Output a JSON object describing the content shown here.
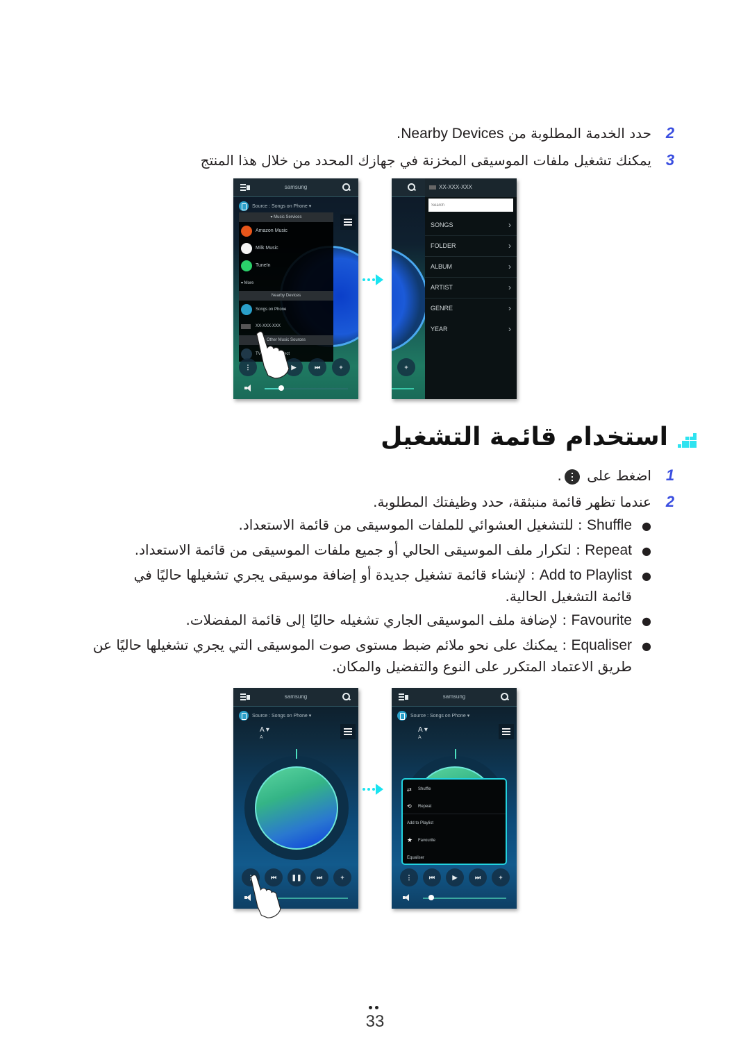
{
  "top_steps": [
    {
      "num": "2",
      "text_ar": "حدد الخدمة المطلوبة من",
      "text_latin": "Nearby Devices",
      "suffix": "."
    },
    {
      "num": "3",
      "text_ar": "يمكنك تشغيل ملفات الموسيقى المخزنة في جهازك المحدد من خلال هذا المنتج",
      "text_latin": "",
      "suffix": ""
    }
  ],
  "screen1": {
    "app_title": "samsung",
    "source_label": "Source : Songs on Phone ▾",
    "music_services_header": "▾ Music Services",
    "services": [
      "Amazon Music",
      "Milk Music",
      "TuneIn"
    ],
    "more_label": "▾ More",
    "nearby_header": "Nearby Devices",
    "nearby_items": [
      "Songs on Phone",
      "XX-XXX-XXX"
    ],
    "other_header": "Other Music Sources",
    "other_items": [
      "TV SoundConnect"
    ],
    "volume_fraction": 0.2
  },
  "screen2": {
    "device_name": "XX-XXX-XXX",
    "search_placeholder": "Search",
    "categories": [
      "SONGS",
      "FOLDER",
      "ALBUM",
      "ARTIST",
      "GENRE",
      "YEAR"
    ],
    "chevron": "›"
  },
  "section": {
    "title": "استخدام قائمة التشغيل",
    "accent_color": "#2ee3f0"
  },
  "steps": [
    {
      "num": "1",
      "text": "اضغط على",
      "suffix": "."
    },
    {
      "num": "2",
      "text": "عندما تظهر قائمة منبثقة، حدد وظيفتك المطلوبة."
    }
  ],
  "options": [
    {
      "name": "Shuffle",
      "desc": " : للتشغيل العشوائي للملفات الموسيقى من قائمة الاستعداد."
    },
    {
      "name": "Repeat",
      "desc": " : لتكرار ملف الموسيقى الحالي أو جميع ملفات الموسيقى من قائمة الاستعداد."
    },
    {
      "name": "Add to Playlist",
      "desc": " : لإنشاء قائمة تشغيل جديدة أو إضافة موسيقى يجري تشغيلها حاليًا في",
      "desc2": "قائمة التشغيل الحالية."
    },
    {
      "name": "Favourite",
      "desc": " : لإضافة ملف الموسيقى الجاري تشغيله حاليًا إلى قائمة المفضلات."
    },
    {
      "name": "Equaliser",
      "desc": " : يمكنك على نحو ملائم ضبط مستوى صوت الموسيقى التي يجري تشغيلها حاليًا عن",
      "desc2": "طريق الاعتماد المتكرر على النوع والتفضيل والمكان."
    }
  ],
  "screen3": {
    "app_title": "samsung",
    "source_label": "Source : Songs on Phone ▾",
    "track_title": "A ▾",
    "track_artist": "A",
    "volume_fraction": 0.0
  },
  "screen4": {
    "app_title": "samsung",
    "source_label": "Source : Songs on Phone ▾",
    "track_title": "A ▾",
    "track_artist": "A",
    "popup_items": [
      "Shuffle",
      "Repeat",
      "Add to Playlist",
      "Favourite",
      "Equaliser"
    ],
    "volume_fraction": 0.1
  },
  "page_number": "33"
}
